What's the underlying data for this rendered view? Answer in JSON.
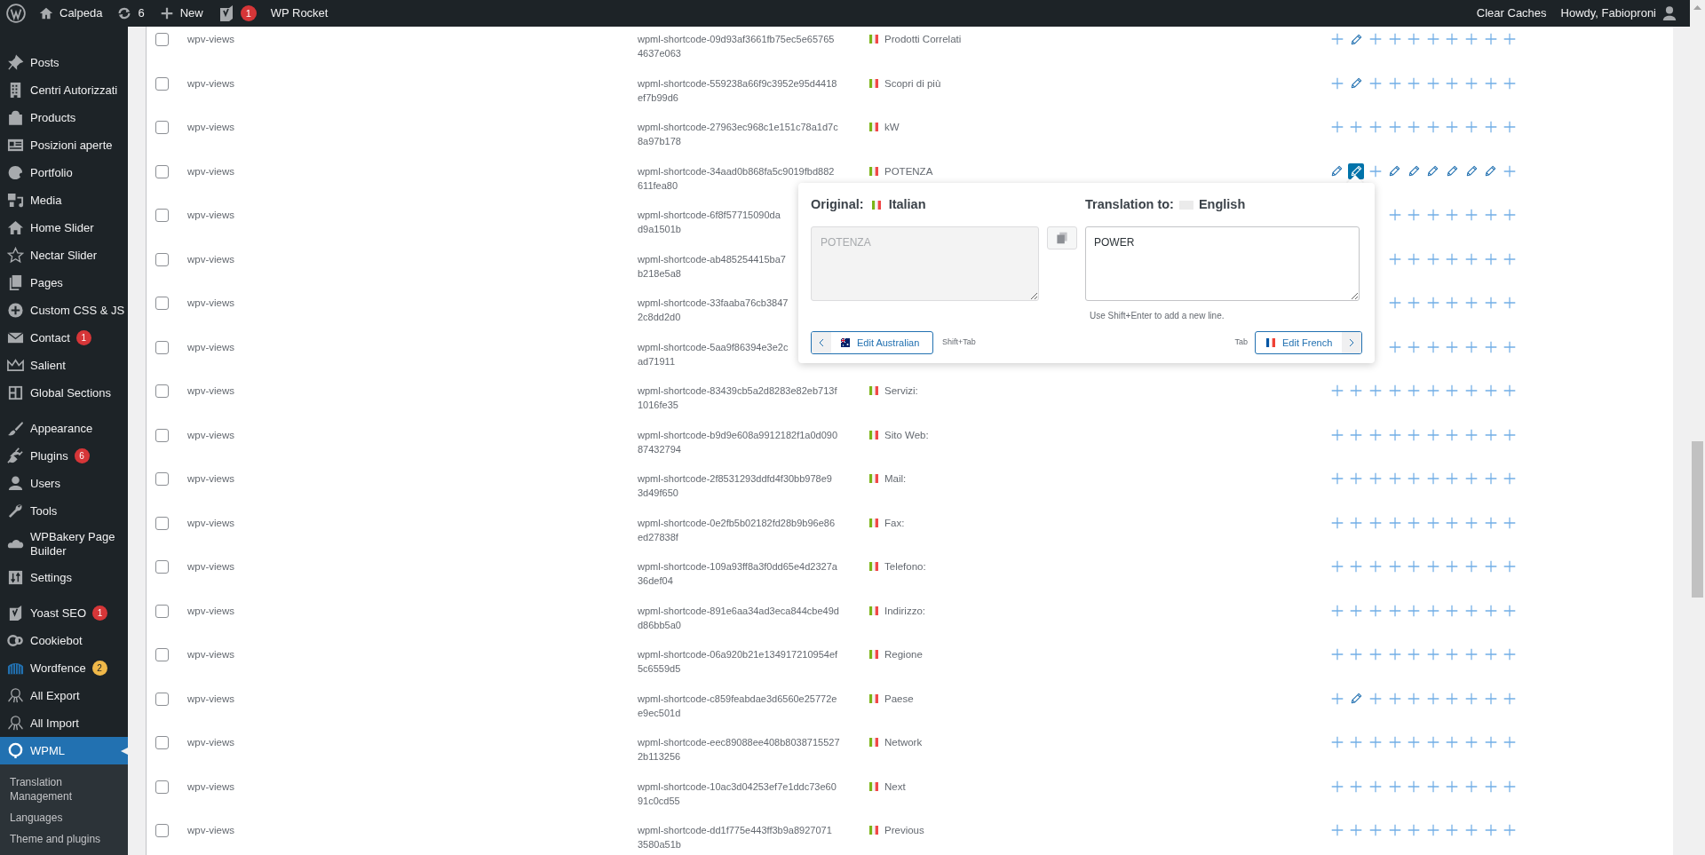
{
  "admin_bar": {
    "site": "Calpeda",
    "updates": "6",
    "new": "New",
    "seo_badge": "1",
    "rocket": "WP Rocket",
    "clear_caches": "Clear Caches",
    "howdy": "Howdy, Fabioproni"
  },
  "sidebar": {
    "groups": [
      [
        {
          "label": "Posts",
          "selected": false
        },
        {
          "label": "Centri Autorizzati",
          "selected": false
        },
        {
          "label": "Products",
          "selected": false
        },
        {
          "label": "Posizioni aperte",
          "selected": false
        },
        {
          "label": "Portfolio",
          "selected": false
        },
        {
          "label": "Media",
          "selected": false
        },
        {
          "label": "Home Slider",
          "selected": false
        },
        {
          "label": "Nectar Slider",
          "selected": false
        },
        {
          "label": "Pages",
          "selected": false
        },
        {
          "label": "Custom CSS & JS",
          "selected": false
        },
        {
          "label": "Contact",
          "badge": "1",
          "color": "#d63638",
          "selected": false
        },
        {
          "label": "Salient",
          "selected": false
        },
        {
          "label": "Global Sections",
          "selected": false
        }
      ],
      [
        {
          "label": "Appearance",
          "selected": false
        },
        {
          "label": "Plugins",
          "badge": "6",
          "color": "#d63638",
          "selected": false
        },
        {
          "label": "Users",
          "selected": false
        },
        {
          "label": "Tools",
          "selected": false
        },
        {
          "label": "WPBakery Page Builder",
          "selected": false
        },
        {
          "label": "Settings",
          "selected": false
        }
      ],
      [
        {
          "label": "Yoast SEO",
          "badge": "1",
          "color": "#d63638",
          "selected": false
        },
        {
          "label": "Cookiebot",
          "selected": false
        },
        {
          "label": "Wordfence",
          "badge": "2",
          "color": "#f0b849",
          "selected": false
        },
        {
          "label": "All Export",
          "selected": false
        },
        {
          "label": "All Import",
          "selected": false
        },
        {
          "label": "WPML",
          "selected": true,
          "children": [
            {
              "label": "Translation Management"
            },
            {
              "label": "Languages"
            },
            {
              "label": "Theme and plugins"
            }
          ]
        }
      ]
    ]
  },
  "rows": [
    {
      "checked": false,
      "context": "wpv-views",
      "name_lines": [
        "wpml-shortcode-09d93af3661fb75ec5e65765",
        "4637e063"
      ],
      "value": "Prodotti Correlati",
      "translations": [
        {
          "kind": "add",
          "selected": false
        },
        {
          "kind": "edit",
          "selected": false
        },
        {
          "kind": "add",
          "selected": false
        },
        {
          "kind": "add",
          "selected": false
        },
        {
          "kind": "add",
          "selected": false
        },
        {
          "kind": "add",
          "selected": false
        },
        {
          "kind": "add",
          "selected": false
        },
        {
          "kind": "add",
          "selected": false
        },
        {
          "kind": "add",
          "selected": false
        },
        {
          "kind": "add",
          "selected": false
        }
      ]
    },
    {
      "checked": false,
      "context": "wpv-views",
      "name_lines": [
        "wpml-shortcode-559238a66f9c3952e95d4418",
        "ef7b99d6"
      ],
      "value": "Scopri di più",
      "translations": [
        {
          "kind": "add",
          "selected": false
        },
        {
          "kind": "edit",
          "selected": false
        },
        {
          "kind": "add",
          "selected": false
        },
        {
          "kind": "add",
          "selected": false
        },
        {
          "kind": "add",
          "selected": false
        },
        {
          "kind": "add",
          "selected": false
        },
        {
          "kind": "add",
          "selected": false
        },
        {
          "kind": "add",
          "selected": false
        },
        {
          "kind": "add",
          "selected": false
        },
        {
          "kind": "add",
          "selected": false
        }
      ]
    },
    {
      "checked": false,
      "context": "wpv-views",
      "name_lines": [
        "wpml-shortcode-27963ec968c1e151c78a1d7c",
        "8a97b178"
      ],
      "value": "kW",
      "translations": [
        {
          "kind": "add",
          "selected": false
        },
        {
          "kind": "add",
          "selected": false
        },
        {
          "kind": "add",
          "selected": false
        },
        {
          "kind": "add",
          "selected": false
        },
        {
          "kind": "add",
          "selected": false
        },
        {
          "kind": "add",
          "selected": false
        },
        {
          "kind": "add",
          "selected": false
        },
        {
          "kind": "add",
          "selected": false
        },
        {
          "kind": "add",
          "selected": false
        },
        {
          "kind": "add",
          "selected": false
        }
      ]
    },
    {
      "checked": false,
      "context": "wpv-views",
      "name_lines": [
        "wpml-shortcode-34aad0b868fa5c9019fbd882",
        "611fea80"
      ],
      "value": "POTENZA",
      "translations": [
        {
          "kind": "edit",
          "selected": false
        },
        {
          "kind": "edit",
          "selected": true
        },
        {
          "kind": "add",
          "selected": false
        },
        {
          "kind": "edit",
          "selected": false
        },
        {
          "kind": "edit",
          "selected": false
        },
        {
          "kind": "edit",
          "selected": false
        },
        {
          "kind": "edit",
          "selected": false
        },
        {
          "kind": "edit",
          "selected": false
        },
        {
          "kind": "edit",
          "selected": false
        },
        {
          "kind": "add",
          "selected": false
        }
      ]
    },
    {
      "checked": false,
      "context": "wpv-views",
      "name_lines": [
        "wpml-shortcode-6f8f57715090da",
        "d9a1501b"
      ],
      "translations": [
        {
          "kind": "add",
          "selected": false
        },
        {
          "kind": "add",
          "selected": false
        },
        {
          "kind": "add",
          "selected": false
        },
        {
          "kind": "add",
          "selected": false
        },
        {
          "kind": "add",
          "selected": false
        },
        {
          "kind": "add",
          "selected": false
        },
        {
          "kind": "add",
          "selected": false
        }
      ]
    },
    {
      "checked": false,
      "context": "wpv-views",
      "name_lines": [
        "wpml-shortcode-ab485254415ba7",
        "b218e5a8"
      ],
      "translations": [
        {
          "kind": "add",
          "selected": false
        },
        {
          "kind": "add",
          "selected": false
        },
        {
          "kind": "add",
          "selected": false
        },
        {
          "kind": "add",
          "selected": false
        },
        {
          "kind": "add",
          "selected": false
        },
        {
          "kind": "add",
          "selected": false
        },
        {
          "kind": "add",
          "selected": false
        }
      ]
    },
    {
      "checked": false,
      "context": "wpv-views",
      "name_lines": [
        "wpml-shortcode-33faaba76cb3847",
        "2c8dd2d0"
      ],
      "translations": [
        {
          "kind": "add",
          "selected": false
        },
        {
          "kind": "add",
          "selected": false
        },
        {
          "kind": "add",
          "selected": false
        },
        {
          "kind": "add",
          "selected": false
        },
        {
          "kind": "add",
          "selected": false
        },
        {
          "kind": "add",
          "selected": false
        },
        {
          "kind": "add",
          "selected": false
        }
      ]
    },
    {
      "checked": false,
      "context": "wpv-views",
      "name_lines": [
        "wpml-shortcode-5aa9f86394e3e2c",
        "ad71911"
      ],
      "translations": [
        {
          "kind": "add",
          "selected": false
        },
        {
          "kind": "add",
          "selected": false
        },
        {
          "kind": "add",
          "selected": false
        },
        {
          "kind": "add",
          "selected": false
        },
        {
          "kind": "add",
          "selected": false
        },
        {
          "kind": "add",
          "selected": false
        },
        {
          "kind": "add",
          "selected": false
        }
      ]
    },
    {
      "checked": false,
      "context": "wpv-views",
      "name_lines": [
        "wpml-shortcode-83439cb5a2d8283e82eb713f",
        "1016fe35"
      ],
      "value": "Servizi:",
      "translations": [
        {
          "kind": "add",
          "selected": false
        },
        {
          "kind": "add",
          "selected": false
        },
        {
          "kind": "add",
          "selected": false
        },
        {
          "kind": "add",
          "selected": false
        },
        {
          "kind": "add",
          "selected": false
        },
        {
          "kind": "add",
          "selected": false
        },
        {
          "kind": "add",
          "selected": false
        },
        {
          "kind": "add",
          "selected": false
        },
        {
          "kind": "add",
          "selected": false
        },
        {
          "kind": "add",
          "selected": false
        }
      ]
    },
    {
      "checked": false,
      "context": "wpv-views",
      "name_lines": [
        "wpml-shortcode-b9d9e608a9912182f1a0d090",
        "87432794"
      ],
      "value": "Sito Web:",
      "translations": [
        {
          "kind": "add",
          "selected": false
        },
        {
          "kind": "add",
          "selected": false
        },
        {
          "kind": "add",
          "selected": false
        },
        {
          "kind": "add",
          "selected": false
        },
        {
          "kind": "add",
          "selected": false
        },
        {
          "kind": "add",
          "selected": false
        },
        {
          "kind": "add",
          "selected": false
        },
        {
          "kind": "add",
          "selected": false
        },
        {
          "kind": "add",
          "selected": false
        },
        {
          "kind": "add",
          "selected": false
        }
      ]
    },
    {
      "checked": false,
      "context": "wpv-views",
      "name_lines": [
        "wpml-shortcode-2f8531293ddfd4f30bb978e9",
        "3d49f650"
      ],
      "value": "Mail:",
      "translations": [
        {
          "kind": "add",
          "selected": false
        },
        {
          "kind": "add",
          "selected": false
        },
        {
          "kind": "add",
          "selected": false
        },
        {
          "kind": "add",
          "selected": false
        },
        {
          "kind": "add",
          "selected": false
        },
        {
          "kind": "add",
          "selected": false
        },
        {
          "kind": "add",
          "selected": false
        },
        {
          "kind": "add",
          "selected": false
        },
        {
          "kind": "add",
          "selected": false
        },
        {
          "kind": "add",
          "selected": false
        }
      ]
    },
    {
      "checked": false,
      "context": "wpv-views",
      "name_lines": [
        "wpml-shortcode-0e2fb5b02182fd28b9b96e86",
        "ed27838f"
      ],
      "value": "Fax:",
      "translations": [
        {
          "kind": "add",
          "selected": false
        },
        {
          "kind": "add",
          "selected": false
        },
        {
          "kind": "add",
          "selected": false
        },
        {
          "kind": "add",
          "selected": false
        },
        {
          "kind": "add",
          "selected": false
        },
        {
          "kind": "add",
          "selected": false
        },
        {
          "kind": "add",
          "selected": false
        },
        {
          "kind": "add",
          "selected": false
        },
        {
          "kind": "add",
          "selected": false
        },
        {
          "kind": "add",
          "selected": false
        }
      ]
    },
    {
      "checked": false,
      "context": "wpv-views",
      "name_lines": [
        "wpml-shortcode-109a93ff8a3f0dd65e4d2327a",
        "36def04"
      ],
      "value": "Telefono:",
      "translations": [
        {
          "kind": "add",
          "selected": false
        },
        {
          "kind": "add",
          "selected": false
        },
        {
          "kind": "add",
          "selected": false
        },
        {
          "kind": "add",
          "selected": false
        },
        {
          "kind": "add",
          "selected": false
        },
        {
          "kind": "add",
          "selected": false
        },
        {
          "kind": "add",
          "selected": false
        },
        {
          "kind": "add",
          "selected": false
        },
        {
          "kind": "add",
          "selected": false
        },
        {
          "kind": "add",
          "selected": false
        }
      ]
    },
    {
      "checked": false,
      "context": "wpv-views",
      "name_lines": [
        "wpml-shortcode-891e6aa34ad3eca844cbe49d",
        "d86bb5a0"
      ],
      "value": "Indirizzo:",
      "translations": [
        {
          "kind": "add",
          "selected": false
        },
        {
          "kind": "add",
          "selected": false
        },
        {
          "kind": "add",
          "selected": false
        },
        {
          "kind": "add",
          "selected": false
        },
        {
          "kind": "add",
          "selected": false
        },
        {
          "kind": "add",
          "selected": false
        },
        {
          "kind": "add",
          "selected": false
        },
        {
          "kind": "add",
          "selected": false
        },
        {
          "kind": "add",
          "selected": false
        },
        {
          "kind": "add",
          "selected": false
        }
      ]
    },
    {
      "checked": false,
      "context": "wpv-views",
      "name_lines": [
        "wpml-shortcode-06a920b21e134917210954ef",
        "5c6559d5"
      ],
      "value": "Regione",
      "translations": [
        {
          "kind": "add",
          "selected": false
        },
        {
          "kind": "add",
          "selected": false
        },
        {
          "kind": "add",
          "selected": false
        },
        {
          "kind": "add",
          "selected": false
        },
        {
          "kind": "add",
          "selected": false
        },
        {
          "kind": "add",
          "selected": false
        },
        {
          "kind": "add",
          "selected": false
        },
        {
          "kind": "add",
          "selected": false
        },
        {
          "kind": "add",
          "selected": false
        },
        {
          "kind": "add",
          "selected": false
        }
      ]
    },
    {
      "checked": false,
      "context": "wpv-views",
      "name_lines": [
        "wpml-shortcode-c859feabdae3d6560e25772e",
        "e9ec501d"
      ],
      "value": "Paese",
      "translations": [
        {
          "kind": "add",
          "selected": false
        },
        {
          "kind": "edit",
          "selected": false
        },
        {
          "kind": "add",
          "selected": false
        },
        {
          "kind": "add",
          "selected": false
        },
        {
          "kind": "add",
          "selected": false
        },
        {
          "kind": "add",
          "selected": false
        },
        {
          "kind": "add",
          "selected": false
        },
        {
          "kind": "add",
          "selected": false
        },
        {
          "kind": "add",
          "selected": false
        },
        {
          "kind": "add",
          "selected": false
        }
      ]
    },
    {
      "checked": false,
      "context": "wpv-views",
      "name_lines": [
        "wpml-shortcode-eec89088ee408b8038715527",
        "2b113256"
      ],
      "value": "Network",
      "translations": [
        {
          "kind": "add",
          "selected": false
        },
        {
          "kind": "add",
          "selected": false
        },
        {
          "kind": "add",
          "selected": false
        },
        {
          "kind": "add",
          "selected": false
        },
        {
          "kind": "add",
          "selected": false
        },
        {
          "kind": "add",
          "selected": false
        },
        {
          "kind": "add",
          "selected": false
        },
        {
          "kind": "add",
          "selected": false
        },
        {
          "kind": "add",
          "selected": false
        },
        {
          "kind": "add",
          "selected": false
        }
      ]
    },
    {
      "checked": false,
      "context": "wpv-views",
      "name_lines": [
        "wpml-shortcode-10ac3d04253ef7e1ddc73e60",
        "91c0cd55"
      ],
      "value": "Next",
      "translations": [
        {
          "kind": "add",
          "selected": false
        },
        {
          "kind": "add",
          "selected": false
        },
        {
          "kind": "add",
          "selected": false
        },
        {
          "kind": "add",
          "selected": false
        },
        {
          "kind": "add",
          "selected": false
        },
        {
          "kind": "add",
          "selected": false
        },
        {
          "kind": "add",
          "selected": false
        },
        {
          "kind": "add",
          "selected": false
        },
        {
          "kind": "add",
          "selected": false
        },
        {
          "kind": "add",
          "selected": false
        }
      ]
    },
    {
      "checked": false,
      "context": "wpv-views",
      "name_lines": [
        "wpml-shortcode-dd1f775e443ff3b9a8927071",
        "3580a51b"
      ],
      "value": "Previous",
      "translations": [
        {
          "kind": "add",
          "selected": false
        },
        {
          "kind": "add",
          "selected": false
        },
        {
          "kind": "add",
          "selected": false
        },
        {
          "kind": "add",
          "selected": false
        },
        {
          "kind": "add",
          "selected": false
        },
        {
          "kind": "add",
          "selected": false
        },
        {
          "kind": "add",
          "selected": false
        },
        {
          "kind": "add",
          "selected": false
        },
        {
          "kind": "add",
          "selected": false
        },
        {
          "kind": "add",
          "selected": false
        }
      ]
    }
  ],
  "popup": {
    "original_label": "Original:",
    "original_language": "Italian",
    "original_text": "POTENZA",
    "translation_label": "Translation to:",
    "translation_language": "English",
    "translation_text": "POWER",
    "hint": "Use Shift+Enter to add a new line.",
    "prev_button": "Edit Australian",
    "prev_shortcut": "Shift+Tab",
    "next_shortcut": "Tab",
    "next_button": "Edit French"
  }
}
